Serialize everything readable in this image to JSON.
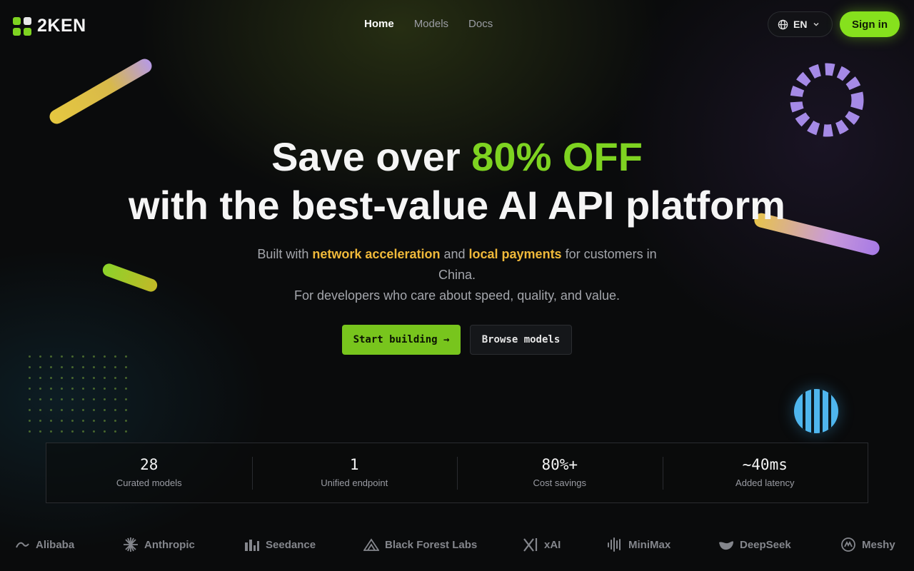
{
  "header": {
    "brand": "2KEN",
    "nav": [
      {
        "label": "Home",
        "active": true
      },
      {
        "label": "Models",
        "active": false
      },
      {
        "label": "Docs",
        "active": false
      }
    ],
    "language": "EN",
    "sign_in": "Sign in"
  },
  "hero": {
    "title_prefix": "Save over ",
    "title_accent": "80% OFF",
    "title_line2": "with the best-value AI API platform",
    "subtitle_part1": "Built with ",
    "subtitle_highlight1": "network acceleration",
    "subtitle_part2": " and ",
    "subtitle_highlight2": "local payments",
    "subtitle_part3": " for customers in China.",
    "subtitle_line2": "For developers who care about speed, quality, and value.",
    "primary_cta": "Start building →",
    "secondary_cta": "Browse models"
  },
  "stats": [
    {
      "value": "28",
      "label": "Curated models"
    },
    {
      "value": "1",
      "label": "Unified endpoint"
    },
    {
      "value": "80%+",
      "label": "Cost savings"
    },
    {
      "value": "~40ms",
      "label": "Added latency"
    }
  ],
  "partners": [
    {
      "name": "Alibaba",
      "icon": "alibaba-icon"
    },
    {
      "name": "Anthropic",
      "icon": "anthropic-icon"
    },
    {
      "name": "Seedance",
      "icon": "seedance-icon"
    },
    {
      "name": "Black Forest Labs",
      "icon": "black-forest-labs-icon"
    },
    {
      "name": "xAI",
      "icon": "xai-icon"
    },
    {
      "name": "MiniMax",
      "icon": "minimax-icon"
    },
    {
      "name": "DeepSeek",
      "icon": "deepseek-icon"
    },
    {
      "name": "Meshy",
      "icon": "meshy-icon"
    }
  ],
  "colors": {
    "accent_green": "#7ed321",
    "highlight_orange": "#f0b93a",
    "background": "#0a0b0c"
  }
}
